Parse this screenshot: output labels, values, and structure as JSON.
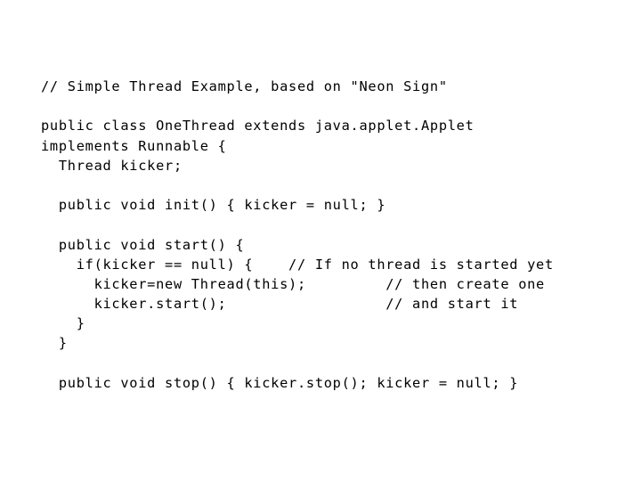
{
  "slide": {
    "background_color": "#ffffff",
    "text_color": "#000000",
    "title_comment": "// Simple Thread Example, based on \"Neon Sign\"",
    "language": "Java"
  },
  "code": {
    "lines": [
      "// Simple Thread Example, based on \"Neon Sign\"",
      "",
      "public class OneThread extends java.applet.Applet",
      "implements Runnable {",
      "  Thread kicker;",
      "",
      "  public void init() { kicker = null; }",
      "",
      "  public void start() {",
      "    if(kicker == null) {    // If no thread is started yet",
      "      kicker=new Thread(this);         // then create one",
      "      kicker.start();                  // and start it",
      "    }",
      "  }",
      "",
      "  public void stop() { kicker.stop(); kicker = null; }"
    ]
  }
}
